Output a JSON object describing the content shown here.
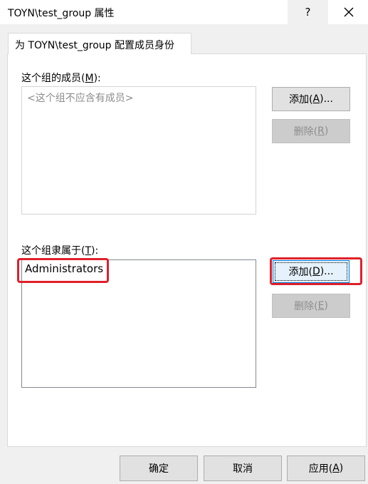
{
  "window": {
    "title": "TOYN\\test_group 属性",
    "help_label": "?"
  },
  "tab": {
    "label": "为 TOYN\\test_group 配置成员身份"
  },
  "members": {
    "label_prefix": "这个组的成员(",
    "label_key": "M",
    "label_suffix": "):",
    "placeholder": "<这个组不应含有成员>",
    "add_prefix": "添加(",
    "add_key": "A",
    "add_suffix": ")...",
    "remove_prefix": "删除(",
    "remove_key": "R",
    "remove_suffix": ")"
  },
  "member_of": {
    "label_prefix": "这个组隶属于(",
    "label_key": "T",
    "label_suffix": "):",
    "items": [
      "Administrators"
    ],
    "add_prefix": "添加(",
    "add_key": "D",
    "add_suffix": ")...",
    "remove_prefix": "删除(",
    "remove_key": "E",
    "remove_suffix": ")"
  },
  "footer": {
    "ok": "确定",
    "cancel": "取消",
    "apply_prefix": "应用(",
    "apply_key": "A",
    "apply_suffix": ")"
  },
  "colors": {
    "highlight": "#e0202a",
    "focus_border": "#0078d7"
  }
}
